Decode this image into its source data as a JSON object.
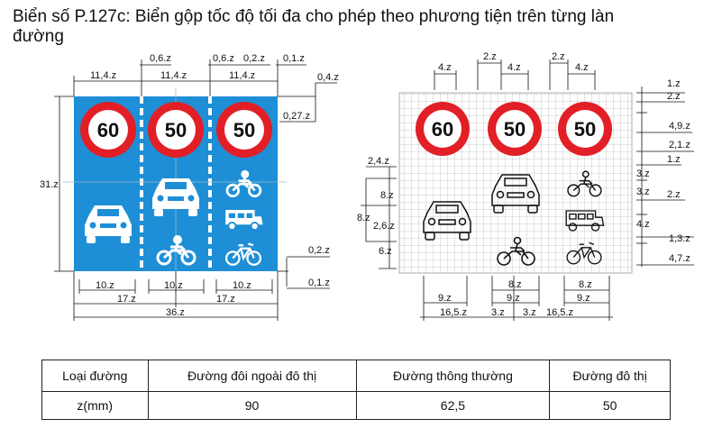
{
  "title": "Biển số P.127c: Biển gộp tốc độ tối đa cho phép theo phương tiện trên từng làn đường",
  "colors": {
    "sign_blue": "#1e8fd6",
    "ring_red": "#e21f26",
    "grid": "#bdbdbd"
  },
  "left_figure": {
    "speeds": [
      "60",
      "50",
      "50"
    ],
    "dims": {
      "top_lanes": [
        "11,4.z",
        "11,4.z",
        "11,4.z"
      ],
      "top_small": [
        "0,6.z",
        "0,6.z",
        "0,2.z",
        "0,1.z"
      ],
      "right_top": [
        "0,4.z",
        "0,27.z"
      ],
      "height": "31.z",
      "right_bottom": [
        "0,2.z",
        "0,1.z"
      ],
      "bottom_symbols": [
        "10.z",
        "10.z",
        "10.z"
      ],
      "bottom_mid": [
        "17.z",
        "17.z"
      ],
      "total_width": "36.z"
    }
  },
  "right_figure": {
    "speeds": [
      "60",
      "50",
      "50"
    ],
    "dims": {
      "top": [
        "4.z",
        "2.z",
        "4.z",
        "2.z",
        "4.z"
      ],
      "right": [
        "1.z",
        "2.z",
        "4,9.z",
        "2,1.z",
        "1.z",
        "3.z",
        "2.z",
        "3.z",
        "4.z",
        "1,3.z",
        "4,7.z"
      ],
      "left": [
        "2,4.z",
        "8.z",
        "2,6.z",
        "8.z",
        "6.z"
      ],
      "bottom_row1": [
        "8.z",
        "8.z"
      ],
      "bottom_row2": [
        "9.z",
        "9.z",
        "9.z"
      ],
      "bottom_row3": [
        "16,5.z",
        "3.z",
        "3.z",
        "16,5.z"
      ]
    }
  },
  "table": {
    "headers": [
      "Loại đường",
      "Đường đôi ngoài đô thị",
      "Đường thông thường",
      "Đường đô thị"
    ],
    "row": [
      "z(mm)",
      "90",
      "62,5",
      "50"
    ]
  }
}
